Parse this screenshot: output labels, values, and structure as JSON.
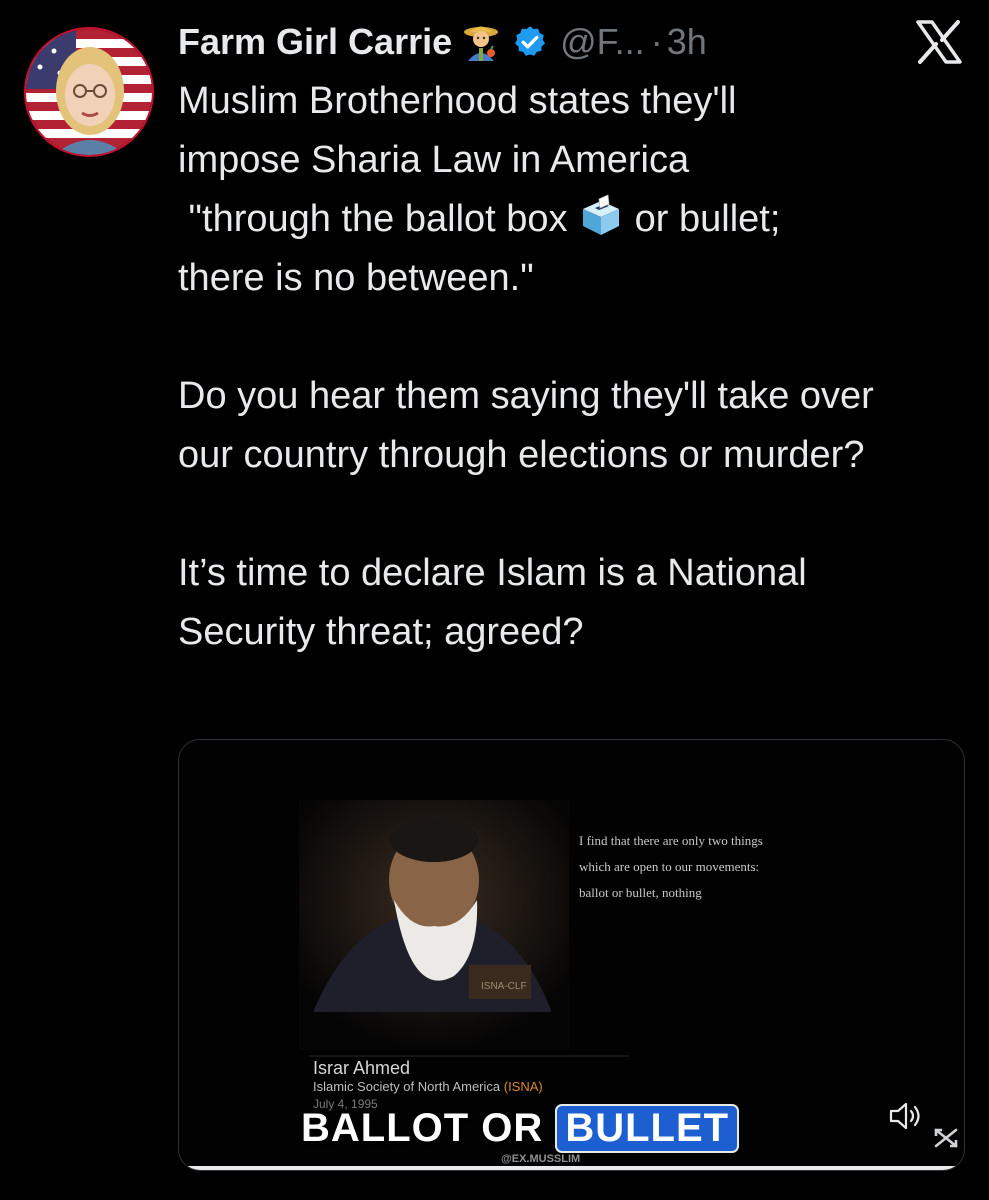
{
  "tweet": {
    "author": {
      "display_name": "Farm Girl Carrie",
      "name_emoji": "farmer-icon",
      "verified_icon": "verified-badge-icon",
      "handle": "@F...",
      "separator": "·",
      "time": "3h"
    },
    "text": {
      "line1": "Muslim Brotherhood states they'll",
      "line2": "impose Sharia Law in America",
      "line3_before": " \"through the ballot box ",
      "line3_emoji": "ballot-box-icon",
      "line3_after": " or bullet;",
      "line4": "there is no between.\"",
      "para2": "Do you hear them saying they'll take over our country through elections or murder?",
      "para3": "It’s time to declare Islam is a National Security threat; agreed?"
    },
    "media": {
      "caption_line1": "I find that there are only two things",
      "caption_line2": "which are open to our movements:",
      "caption_line3": "ballot or bullet, nothing",
      "podium_tag": "ISNA-CLF",
      "speaker_name": "Israr Ahmed",
      "speaker_org": "Islamic Society of North America",
      "speaker_org_abbr": "(ISNA)",
      "speaker_date": "July 4, 1995",
      "banner_left": "BALLOT OR",
      "banner_right": "BULLET",
      "watermark": "@EX.MUSSLIM",
      "volume_icon": "volume-icon",
      "progress_fraction": 1.0
    }
  },
  "close_icon": "x-logo-icon",
  "colors": {
    "background": "#000000",
    "text_primary": "#e7e9ea",
    "text_secondary": "#71767b",
    "verified_blue": "#1d9bf0",
    "banner_blue": "#1d5fd1"
  }
}
